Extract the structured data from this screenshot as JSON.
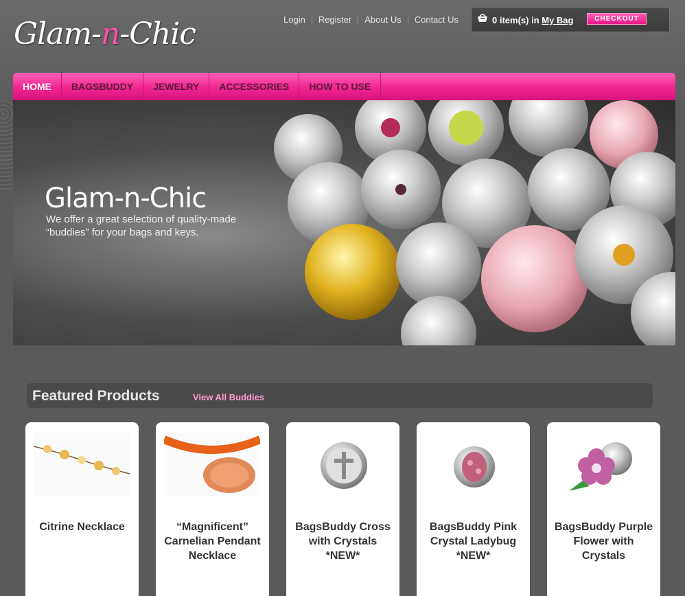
{
  "brand": {
    "logo_text_1": "Glam-",
    "logo_text_2": "n",
    "logo_text_3": "-Chic"
  },
  "toplinks": [
    "Login",
    "Register",
    "About Us",
    "Contact Us"
  ],
  "bag": {
    "count_text": "0 item(s) in",
    "mybag_label": "My Bag",
    "checkout_label": "CHECKOUT"
  },
  "nav": [
    "HOME",
    "BAGSBUDDY",
    "JEWELRY",
    "ACCESSORIES",
    "HOW TO USE"
  ],
  "hero": {
    "title": "Glam-n-Chic",
    "subtitle": "We offer a great selection of quality-made “buddies” for your bags and keys."
  },
  "featured": {
    "title": "Featured Products",
    "view_all": "View All Buddies"
  },
  "products": [
    {
      "name": "Citrine Necklace"
    },
    {
      "name": "“Magnificent” Carnelian Pendant Necklace"
    },
    {
      "name": "BagsBuddy Cross with Crystals *NEW*"
    },
    {
      "name": "BagsBuddy Pink Crystal Ladybug *NEW*"
    },
    {
      "name": "BagsBuddy Purple Flower with Crystals"
    }
  ],
  "colors": {
    "accent_pink": "#f0258f",
    "background": "#5a5a5a",
    "card": "#ffffff"
  }
}
